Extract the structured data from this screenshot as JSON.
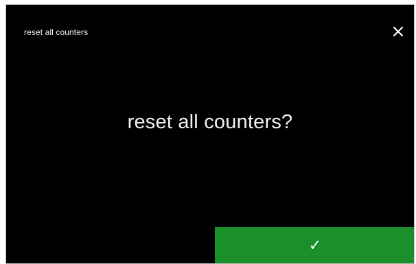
{
  "dialog": {
    "title": "reset all counters",
    "prompt": "reset all counters?",
    "confirm_icon": "check-icon",
    "close_icon": "close-icon",
    "confirm_glyph": "✓"
  },
  "colors": {
    "background": "#000000",
    "text": "#ffffff",
    "confirm_button": "#1a8f2a"
  }
}
